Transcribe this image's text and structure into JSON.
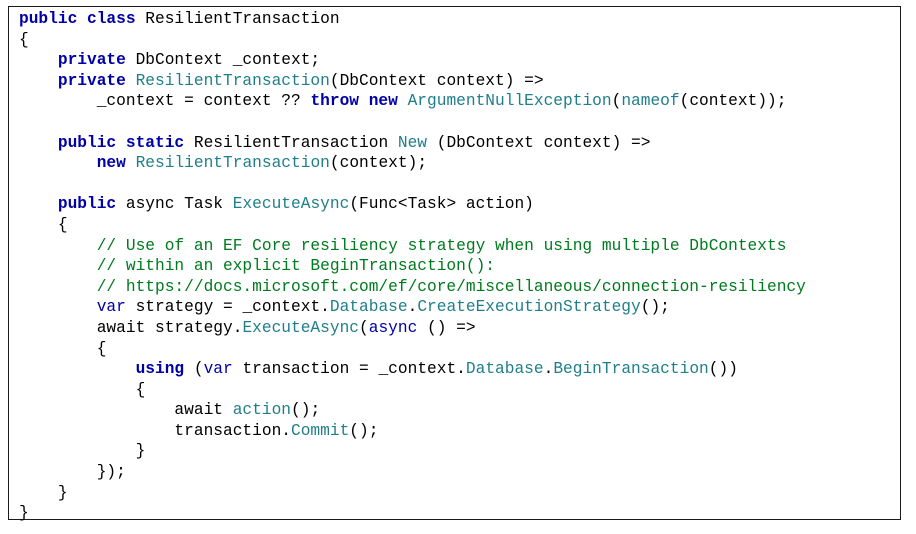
{
  "code": {
    "lines": [
      [
        {
          "t": "public class",
          "c": "kw"
        },
        {
          "t": " ResilientTransaction",
          "c": "tx"
        }
      ],
      [
        {
          "t": "{",
          "c": "tx"
        }
      ],
      [
        {
          "t": "    ",
          "c": "tx"
        },
        {
          "t": "private",
          "c": "kw"
        },
        {
          "t": " DbContext _context;",
          "c": "tx"
        }
      ],
      [
        {
          "t": "    ",
          "c": "tx"
        },
        {
          "t": "private",
          "c": "kw"
        },
        {
          "t": " ",
          "c": "tx"
        },
        {
          "t": "ResilientTransaction",
          "c": "ty"
        },
        {
          "t": "(DbContext context) =>",
          "c": "tx"
        }
      ],
      [
        {
          "t": "        _context = context ?? ",
          "c": "tx"
        },
        {
          "t": "throw new",
          "c": "kw"
        },
        {
          "t": " ",
          "c": "tx"
        },
        {
          "t": "ArgumentNullException",
          "c": "ty"
        },
        {
          "t": "(",
          "c": "tx"
        },
        {
          "t": "nameof",
          "c": "ty"
        },
        {
          "t": "(context));",
          "c": "tx"
        }
      ],
      [
        {
          "t": "",
          "c": "tx"
        }
      ],
      [
        {
          "t": "    ",
          "c": "tx"
        },
        {
          "t": "public static",
          "c": "kw"
        },
        {
          "t": " ResilientTransaction ",
          "c": "tx"
        },
        {
          "t": "New",
          "c": "ty"
        },
        {
          "t": " (DbContext context) =>",
          "c": "tx"
        }
      ],
      [
        {
          "t": "        ",
          "c": "tx"
        },
        {
          "t": "new",
          "c": "kw"
        },
        {
          "t": " ",
          "c": "tx"
        },
        {
          "t": "ResilientTransaction",
          "c": "ty"
        },
        {
          "t": "(context);",
          "c": "tx"
        }
      ],
      [
        {
          "t": "",
          "c": "tx"
        }
      ],
      [
        {
          "t": "    ",
          "c": "tx"
        },
        {
          "t": "public",
          "c": "kw"
        },
        {
          "t": " async Task ",
          "c": "tx"
        },
        {
          "t": "ExecuteAsync",
          "c": "ty"
        },
        {
          "t": "(Func<Task> action)",
          "c": "tx"
        }
      ],
      [
        {
          "t": "    {",
          "c": "tx"
        }
      ],
      [
        {
          "t": "        ",
          "c": "tx"
        },
        {
          "t": "// Use of an EF Core resiliency strategy when using multiple DbContexts",
          "c": "cm"
        }
      ],
      [
        {
          "t": "        ",
          "c": "tx"
        },
        {
          "t": "// within an explicit BeginTransaction():",
          "c": "cm"
        }
      ],
      [
        {
          "t": "        ",
          "c": "tx"
        },
        {
          "t": "// https://docs.microsoft.com/ef/core/miscellaneous/connection-resiliency",
          "c": "cm"
        }
      ],
      [
        {
          "t": "        ",
          "c": "tx"
        },
        {
          "t": "var",
          "c": "kw2"
        },
        {
          "t": " strategy = _context.",
          "c": "tx"
        },
        {
          "t": "Database",
          "c": "ty"
        },
        {
          "t": ".",
          "c": "tx"
        },
        {
          "t": "CreateExecutionStrategy",
          "c": "ty"
        },
        {
          "t": "();",
          "c": "tx"
        }
      ],
      [
        {
          "t": "        await strategy.",
          "c": "tx"
        },
        {
          "t": "ExecuteAsync",
          "c": "ty"
        },
        {
          "t": "(",
          "c": "tx"
        },
        {
          "t": "async",
          "c": "kw2"
        },
        {
          "t": " () =>",
          "c": "tx"
        }
      ],
      [
        {
          "t": "        {",
          "c": "tx"
        }
      ],
      [
        {
          "t": "            ",
          "c": "tx"
        },
        {
          "t": "using",
          "c": "kw"
        },
        {
          "t": " (",
          "c": "tx"
        },
        {
          "t": "var",
          "c": "kw2"
        },
        {
          "t": " transaction = _context.",
          "c": "tx"
        },
        {
          "t": "Database",
          "c": "ty"
        },
        {
          "t": ".",
          "c": "tx"
        },
        {
          "t": "BeginTransaction",
          "c": "ty"
        },
        {
          "t": "())",
          "c": "tx"
        }
      ],
      [
        {
          "t": "            {",
          "c": "tx"
        }
      ],
      [
        {
          "t": "                await ",
          "c": "tx"
        },
        {
          "t": "action",
          "c": "ty"
        },
        {
          "t": "();",
          "c": "tx"
        }
      ],
      [
        {
          "t": "                transaction.",
          "c": "tx"
        },
        {
          "t": "Commit",
          "c": "ty"
        },
        {
          "t": "();",
          "c": "tx"
        }
      ],
      [
        {
          "t": "            }",
          "c": "tx"
        }
      ],
      [
        {
          "t": "        });",
          "c": "tx"
        }
      ],
      [
        {
          "t": "    }",
          "c": "tx"
        }
      ],
      [
        {
          "t": "}",
          "c": "tx"
        }
      ]
    ]
  }
}
